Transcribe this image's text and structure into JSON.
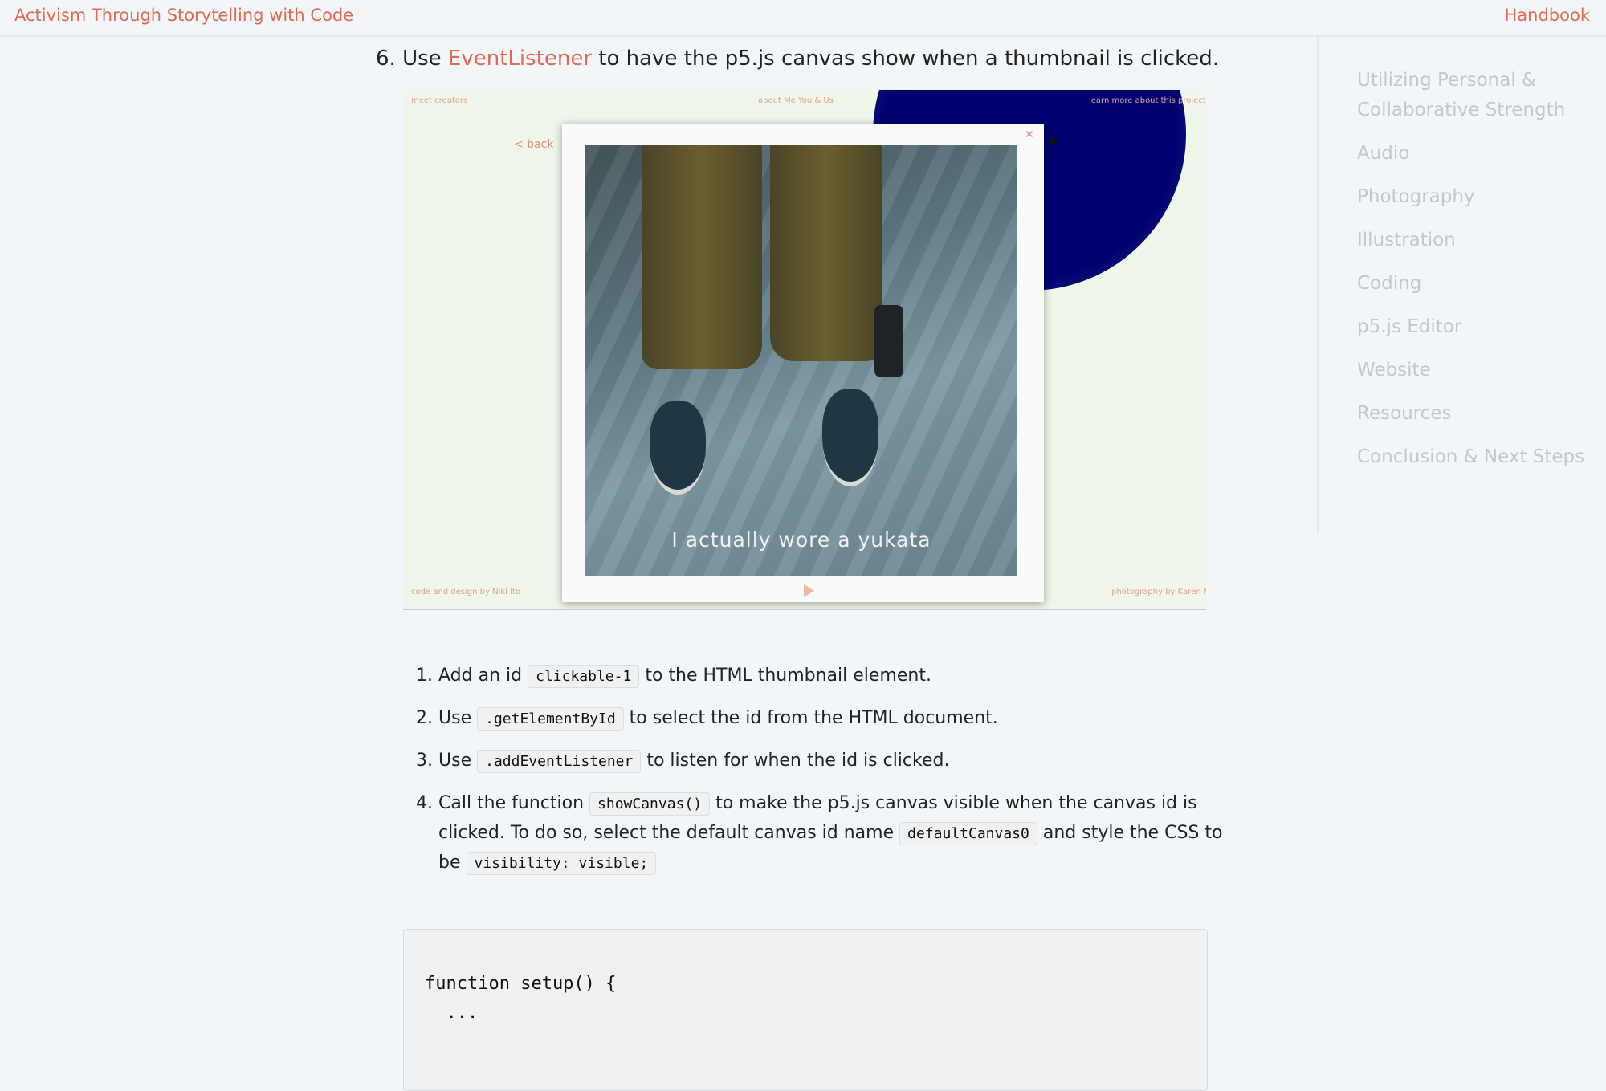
{
  "header": {
    "site_title": "Activism Through Storytelling with Code",
    "handbook_link": "Handbook"
  },
  "sidebar": {
    "items": [
      {
        "label": "Utilizing Personal & Collaborative Strength"
      },
      {
        "label": "Audio"
      },
      {
        "label": "Photography"
      },
      {
        "label": "Illustration"
      },
      {
        "label": "Coding"
      },
      {
        "label": "p5.js Editor"
      },
      {
        "label": "Website"
      },
      {
        "label": "Resources"
      },
      {
        "label": "Conclusion & Next Steps"
      }
    ]
  },
  "main": {
    "step": {
      "number": "6.",
      "prefix": "Use",
      "link": "EventListener",
      "suffix": "to have the p5.js canvas show when a thumbnail is clicked."
    },
    "screenshot": {
      "top_left": "meet creators",
      "top_center": "about Me You & Us",
      "top_right": "learn more about this project",
      "back": "< back",
      "caption": "I actually wore a yukata",
      "bottom_left": "code and design by Niki Ito",
      "bottom_right": "photography by Karen Miko"
    },
    "steps": [
      {
        "pre": "Add an id",
        "code": "clickable-1",
        "post": "to the HTML thumbnail element."
      },
      {
        "pre": "Use",
        "code": ".getElementById",
        "post": "to select the id from the HTML document."
      },
      {
        "pre": "Use",
        "code": ".addEventListener",
        "post": "to listen for when the id is clicked."
      },
      {
        "pre": "Call the function",
        "code": "showCanvas()",
        "mid": "to make the p5.js canvas visible when the canvas id is clicked. To do so, select the default canvas id name",
        "code2": "defaultCanvas0",
        "mid2": "and style the CSS to be",
        "code3": "visibility: visible;"
      }
    ],
    "code_block": {
      "line1": "function setup() {",
      "line2": "  ..."
    }
  },
  "colors": {
    "accent": "#de6b54",
    "sidebar_text": "#c3c8cc",
    "background": "#f2f6f9"
  }
}
